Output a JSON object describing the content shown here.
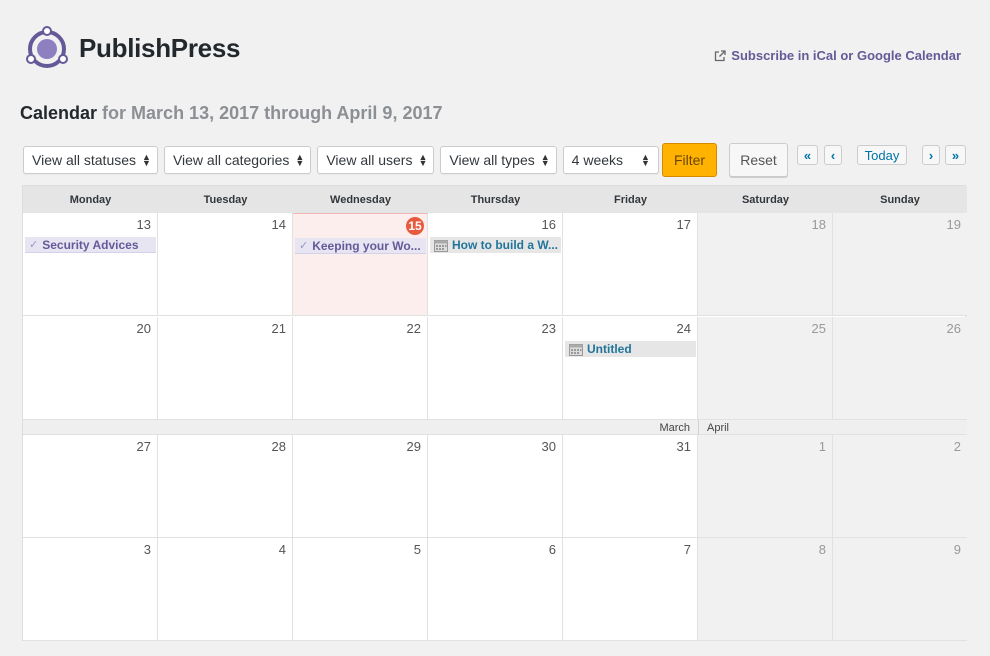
{
  "brand": {
    "name": "PublishPress"
  },
  "subscribe": {
    "label": "Subscribe in iCal or Google Calendar"
  },
  "heading": {
    "title": "Calendar",
    "range": "for March 13, 2017 through April 9, 2017"
  },
  "filters": {
    "statuses": "View all statuses",
    "categories": "View all categories",
    "users": "View all users",
    "types": "View all types",
    "weeks": "4 weeks",
    "filter_button": "Filter",
    "reset_button": "Reset"
  },
  "nav": {
    "first": "«",
    "prev": "‹",
    "today": "Today",
    "next": "›",
    "last": "»"
  },
  "weekdays": [
    "Monday",
    "Tuesday",
    "Wednesday",
    "Thursday",
    "Friday",
    "Saturday",
    "Sunday"
  ],
  "weeks": [
    {
      "days": [
        "13",
        "14",
        "15",
        "16",
        "17",
        "18",
        "19"
      ]
    },
    {
      "days": [
        "20",
        "21",
        "22",
        "23",
        "24",
        "25",
        "26"
      ]
    },
    {
      "days": [
        "27",
        "28",
        "29",
        "30",
        "31",
        "1",
        "2"
      ]
    },
    {
      "days": [
        "3",
        "4",
        "5",
        "6",
        "7",
        "8",
        "9"
      ]
    }
  ],
  "month_separator": {
    "left": "March",
    "right": "April"
  },
  "events": {
    "security": "Security Advices",
    "keeping": "Keeping your Wo...",
    "howto": "How to build a W...",
    "untitled": "Untitled"
  },
  "colors": {
    "accent": "#655997",
    "filter_button": "#ffb300",
    "today_badge": "#e85a3e",
    "link": "#21759b"
  }
}
